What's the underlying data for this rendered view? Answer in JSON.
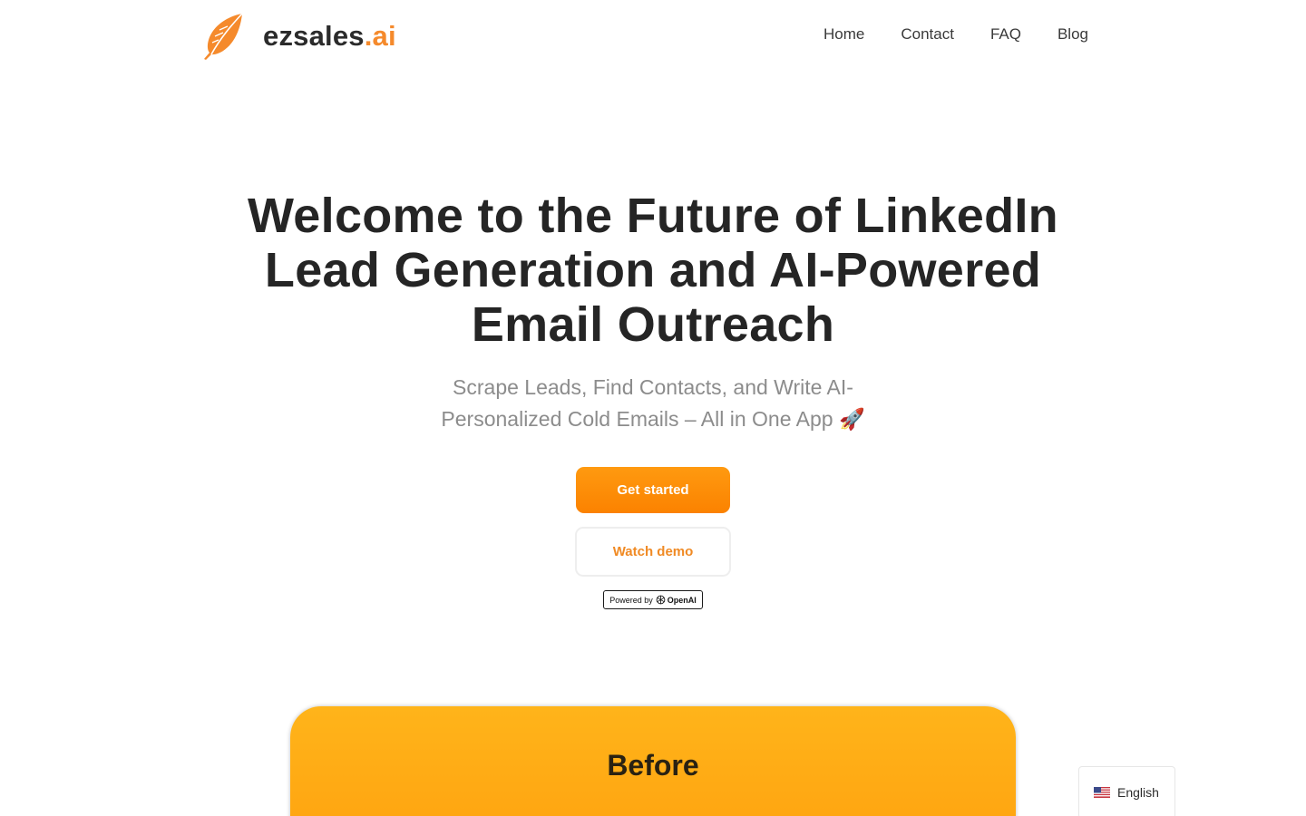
{
  "brand": {
    "name": "ezsales",
    "suffix": ".ai",
    "accent_color": "#f58a2c",
    "icon": "feather-quill-icon"
  },
  "nav": {
    "items": [
      {
        "label": "Home"
      },
      {
        "label": "Contact"
      },
      {
        "label": "FAQ"
      },
      {
        "label": "Blog"
      }
    ]
  },
  "hero": {
    "title": "Welcome to the Future of LinkedIn Lead Generation and AI-Powered Email Outreach",
    "subtitle": "Scrape Leads, Find Contacts, and Write AI-Personalized Cold Emails – All in One App 🚀",
    "primary_button": "Get started",
    "secondary_button": "Watch demo",
    "powered_by": {
      "prefix": "Powered by",
      "brand": "OpenAI",
      "icon": "openai-logo-icon"
    }
  },
  "comparison": {
    "before_title": "Before",
    "card_color": "#ffa20f"
  },
  "language_selector": {
    "label": "English",
    "icon": "us-flag-icon"
  }
}
